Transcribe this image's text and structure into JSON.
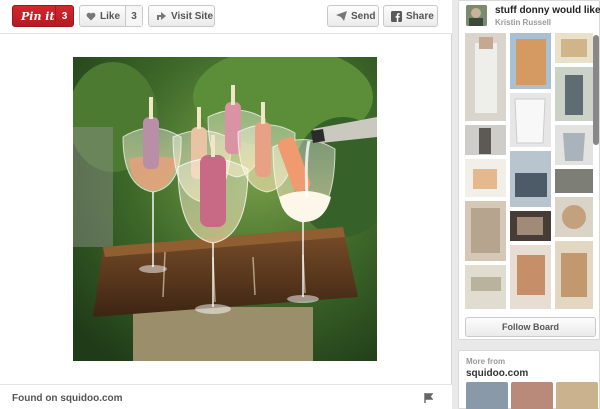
{
  "toolbar": {
    "pinit_label": "Pin it",
    "pinit_count": "3",
    "like_label": "Like",
    "like_count": "3",
    "visit_label": "Visit Site",
    "send_label": "Send",
    "share_label": "Share"
  },
  "found": {
    "text": "Found on squidoo.com"
  },
  "board": {
    "title": "stuff donny would like",
    "owner": "Kristin Russell",
    "follow_label": "Follow Board"
  },
  "more": {
    "label": "More from",
    "source": "squidoo.com"
  },
  "colors": {
    "pinit_red": "#cb2027",
    "background": "#e9e9e9"
  }
}
